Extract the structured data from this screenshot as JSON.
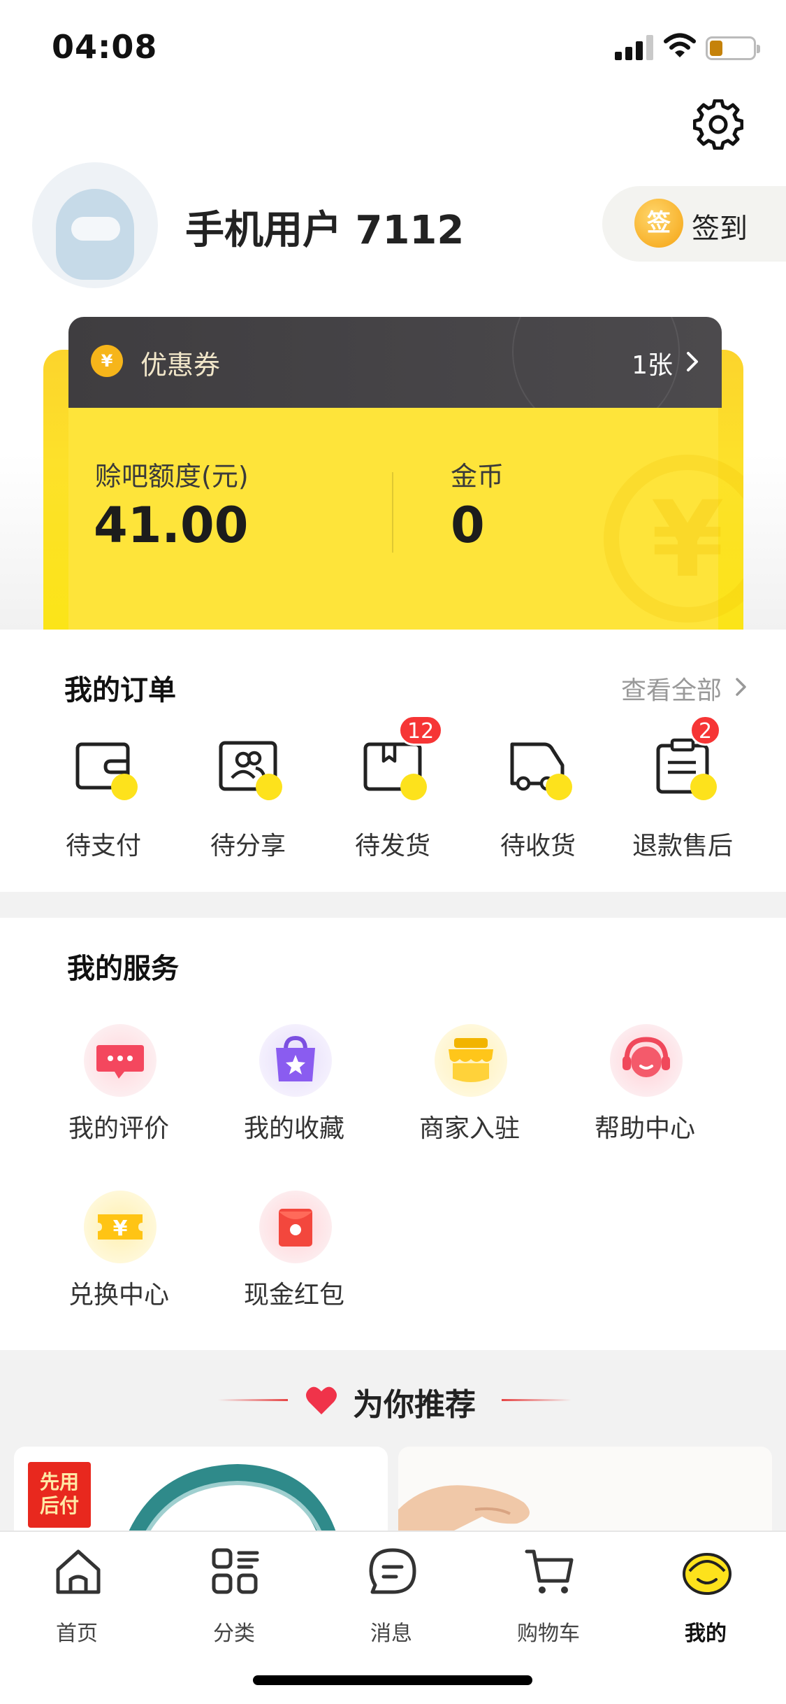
{
  "status_bar": {
    "time": "04:08"
  },
  "profile": {
    "username": "手机用户 7112",
    "checkin_label": "签到",
    "checkin_coin_char": "签"
  },
  "wallet": {
    "coupon_label": "优惠券",
    "coupon_count": "1张",
    "coupon_coin_char": "¥",
    "credit_label": "赊吧额度(元)",
    "credit_value": "41.00",
    "gold_label": "金币",
    "gold_value": "0",
    "watermark_char": "¥"
  },
  "orders": {
    "title": "我的订单",
    "view_all": "查看全部",
    "items": [
      {
        "label": "待支付",
        "icon": "wallet-icon",
        "badge": null
      },
      {
        "label": "待分享",
        "icon": "share-people-icon",
        "badge": null
      },
      {
        "label": "待发货",
        "icon": "package-icon",
        "badge": "12"
      },
      {
        "label": "待收货",
        "icon": "truck-icon",
        "badge": null
      },
      {
        "label": "退款售后",
        "icon": "clipboard-icon",
        "badge": "2"
      }
    ]
  },
  "services": {
    "title": "我的服务",
    "items": [
      {
        "label": "我的评价",
        "icon": "comment-icon"
      },
      {
        "label": "我的收藏",
        "icon": "favorite-bag-icon"
      },
      {
        "label": "商家入驻",
        "icon": "storefront-icon"
      },
      {
        "label": "帮助中心",
        "icon": "customer-service-icon"
      },
      {
        "label": "兑换中心",
        "icon": "ticket-icon"
      },
      {
        "label": "现金红包",
        "icon": "red-packet-icon"
      }
    ],
    "ticket_char": "¥"
  },
  "recommend": {
    "title": "为你推荐",
    "pay_later_badge": "先用\n后付"
  },
  "tabbar": {
    "items": [
      {
        "label": "首页",
        "icon": "home-icon"
      },
      {
        "label": "分类",
        "icon": "category-icon"
      },
      {
        "label": "消息",
        "icon": "message-icon"
      },
      {
        "label": "购物车",
        "icon": "cart-icon"
      },
      {
        "label": "我的",
        "icon": "profile-face-icon",
        "active": true
      }
    ]
  },
  "colors": {
    "accent_yellow": "#fde21c",
    "badge_red": "#f63535",
    "coupon_dark": "#454346"
  }
}
